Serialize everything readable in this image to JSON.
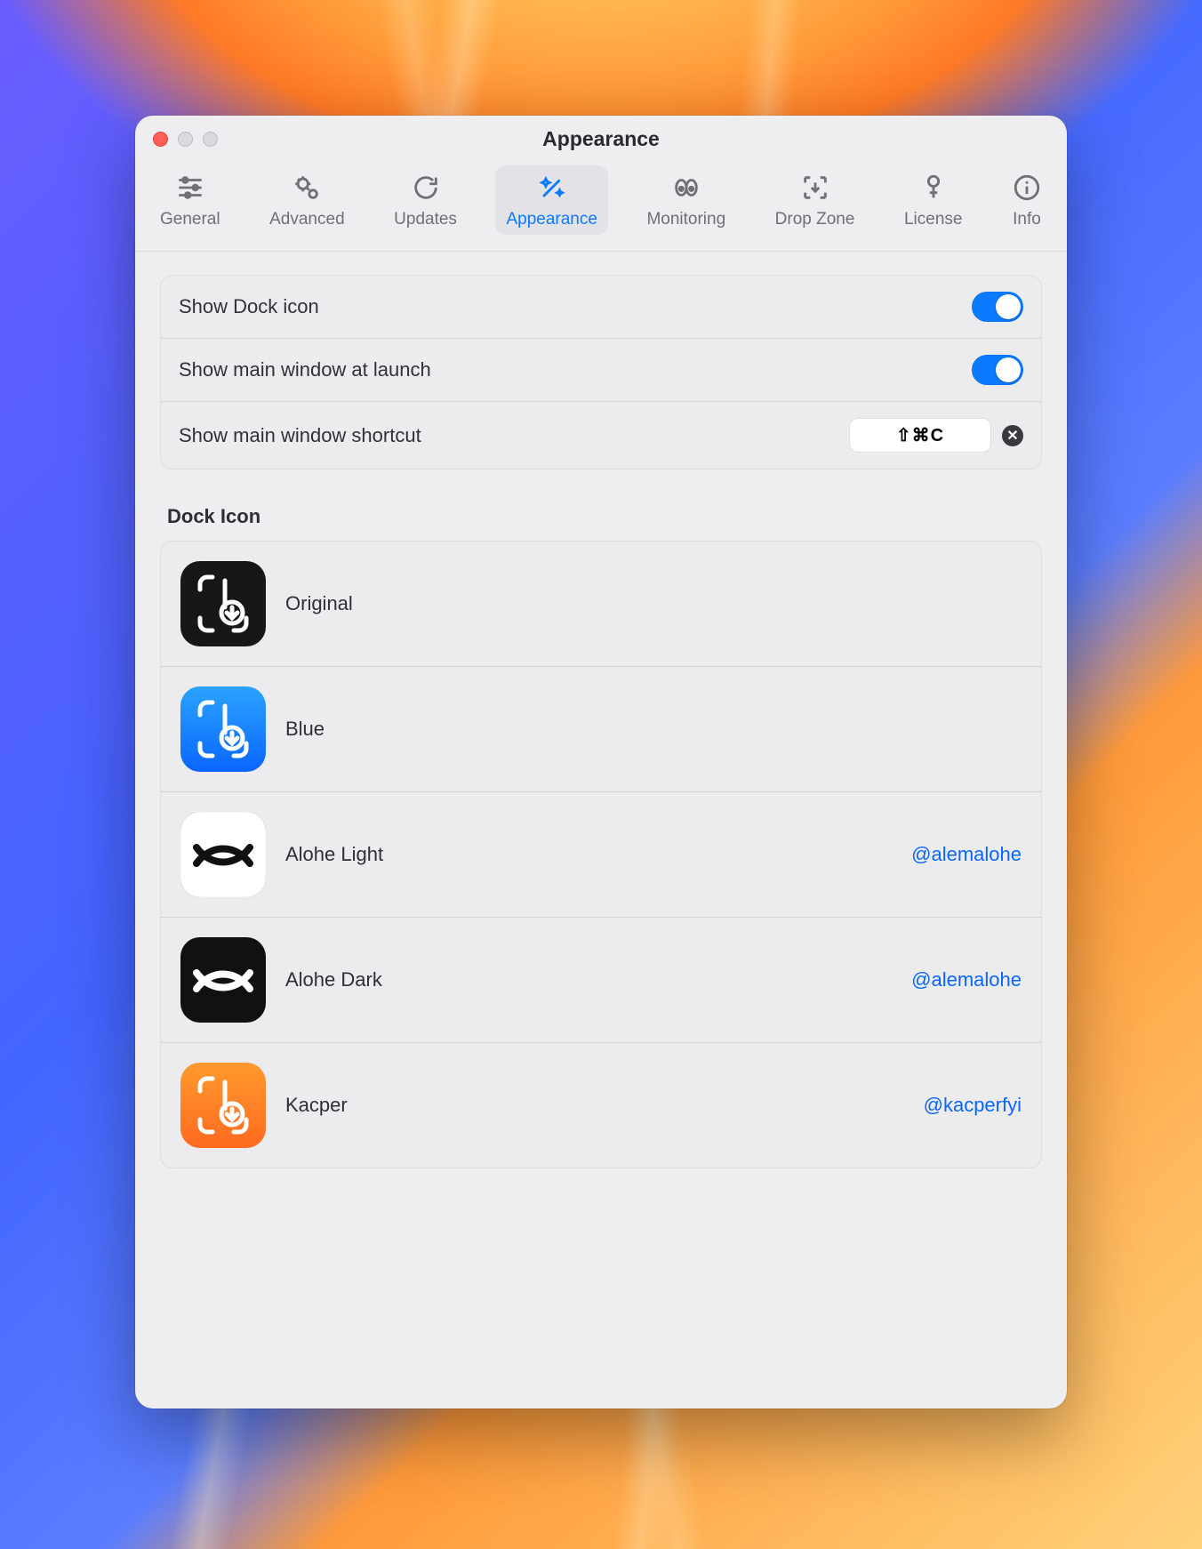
{
  "window": {
    "title": "Appearance"
  },
  "toolbar": {
    "items": [
      {
        "label": "General"
      },
      {
        "label": "Advanced"
      },
      {
        "label": "Updates"
      },
      {
        "label": "Appearance"
      },
      {
        "label": "Monitoring"
      },
      {
        "label": "Drop Zone"
      },
      {
        "label": "License"
      },
      {
        "label": "Info"
      }
    ],
    "active_index": 3
  },
  "settings": {
    "show_dock_icon_label": "Show Dock icon",
    "show_main_launch_label": "Show main window at launch",
    "shortcut_label": "Show main window shortcut",
    "shortcut_value": "⇧⌘C",
    "show_dock_icon_on": true,
    "show_main_launch_on": true
  },
  "dock_section_title": "Dock Icon",
  "dock_icons": [
    {
      "name": "Original",
      "credit": ""
    },
    {
      "name": "Blue",
      "credit": ""
    },
    {
      "name": "Alohe Light",
      "credit": "@alemalohe"
    },
    {
      "name": "Alohe Dark",
      "credit": "@alemalohe"
    },
    {
      "name": "Kacper",
      "credit": "@kacperfyi"
    }
  ],
  "colors": {
    "accent": "#0a7aff",
    "link": "#0a66ff"
  }
}
